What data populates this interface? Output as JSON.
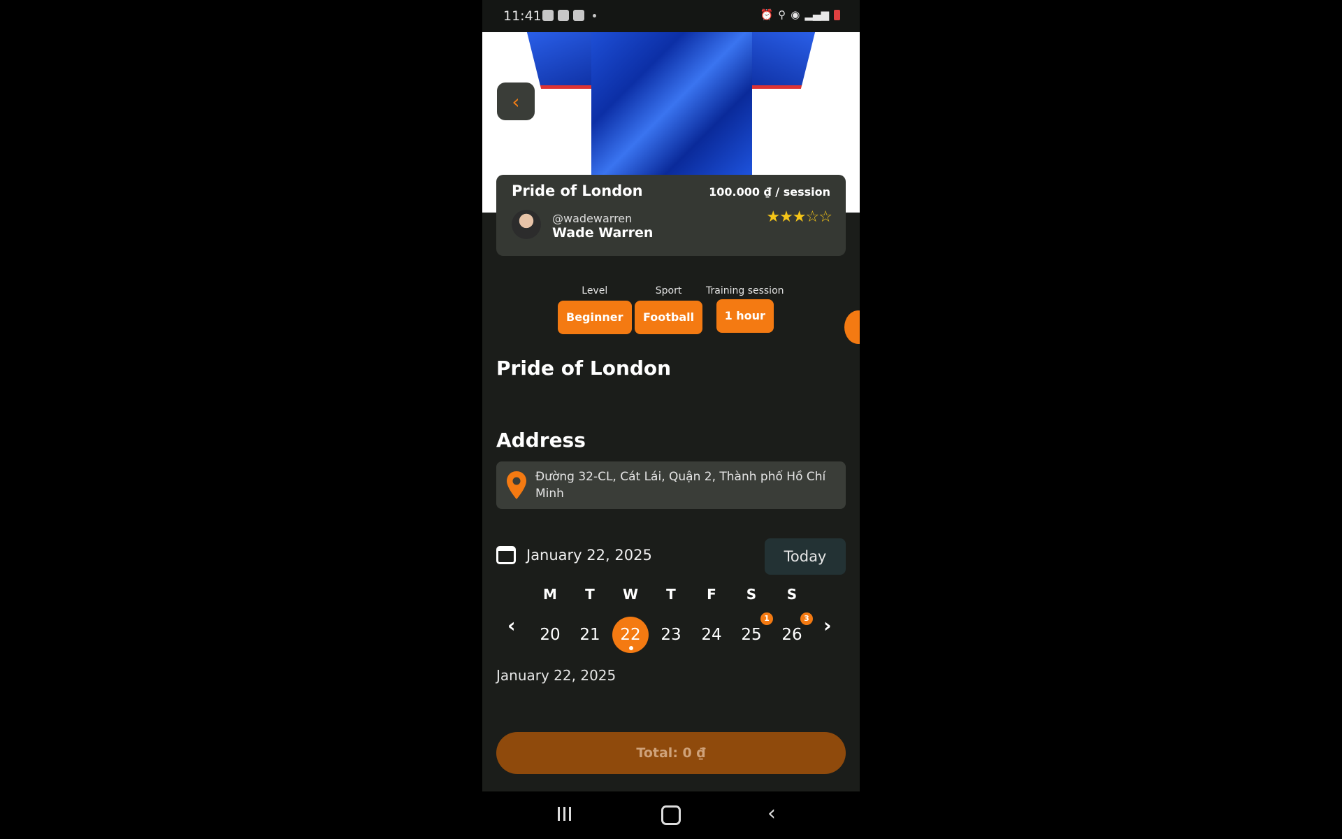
{
  "status_bar": {
    "time": "11:41",
    "icons": [
      "alarm-icon",
      "location-icon",
      "hotspot-icon",
      "signal-icon",
      "battery-low-icon"
    ]
  },
  "hero": {
    "image": "blue football jersey",
    "back_icon": "chevron-left-icon"
  },
  "card": {
    "title": "Pride of London",
    "price": "100.000 ₫ / session",
    "handle": "@wadewarren",
    "name": "Wade Warren",
    "rating": 3,
    "rating_max": 5
  },
  "tags": [
    {
      "label": "Level",
      "value": "Beginner"
    },
    {
      "label": "Sport",
      "value": "Football"
    },
    {
      "label": "Training session",
      "value": "1 hour"
    }
  ],
  "description_title": "Pride of London",
  "address": {
    "title": "Address",
    "text": "Đường 32-CL, Cát Lái, Quận 2, Thành phố Hồ Chí Minh"
  },
  "calendar": {
    "current_date": "January 22, 2025",
    "today_label": "Today",
    "weekdays": [
      "M",
      "T",
      "W",
      "T",
      "F",
      "S",
      "S"
    ],
    "days": [
      "20",
      "21",
      "22",
      "23",
      "24",
      "25",
      "26"
    ],
    "selected_index": 2,
    "badges": [
      {
        "index": 5,
        "count": "1"
      },
      {
        "index": 6,
        "count": "3"
      }
    ],
    "accent": "#f47a12"
  },
  "selected_date": "January 22, 2025",
  "total_label": "Total: 0 ₫"
}
